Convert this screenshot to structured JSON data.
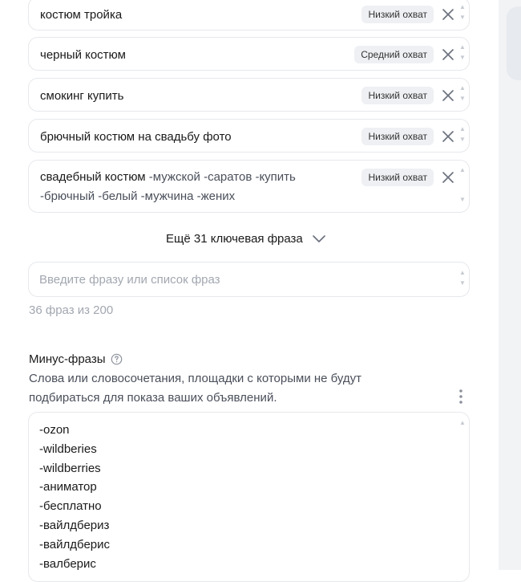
{
  "phrases": [
    {
      "text": "костюм тройка",
      "coverage": "Низкий охват"
    },
    {
      "text": "черный костюм",
      "coverage": "Средний охват"
    },
    {
      "text": "смокинг купить",
      "coverage": "Низкий охват"
    },
    {
      "text": "брючный костюм на свадьбу фото",
      "coverage": "Низкий охват"
    },
    {
      "text_main": "свадебный костюм",
      "text_negatives": "-мужской -саратов -купить -брючный -белый -мужчина -жених",
      "coverage": "Низкий охват"
    }
  ],
  "more_link_label": "Ещё 31 ключевая фраза",
  "input": {
    "placeholder": "Введите фразу или список фраз",
    "value": ""
  },
  "count_text": "36 фраз из 200",
  "minus": {
    "title": "Минус-фразы",
    "description": "Слова или словосочетания, площадки с которыми не будут подбираться для показа ваших объявлений.",
    "items": [
      "-ozon",
      "-wildberies",
      "-wildberries",
      "-аниматор",
      "-бесплатно",
      "-вайлдбериз",
      "-вайлдберис",
      "-валберис"
    ]
  },
  "icons": {
    "close": "close-icon",
    "chevron": "chevron-down-icon",
    "help": "help-circle-icon",
    "menu": "more-vertical-icon"
  }
}
